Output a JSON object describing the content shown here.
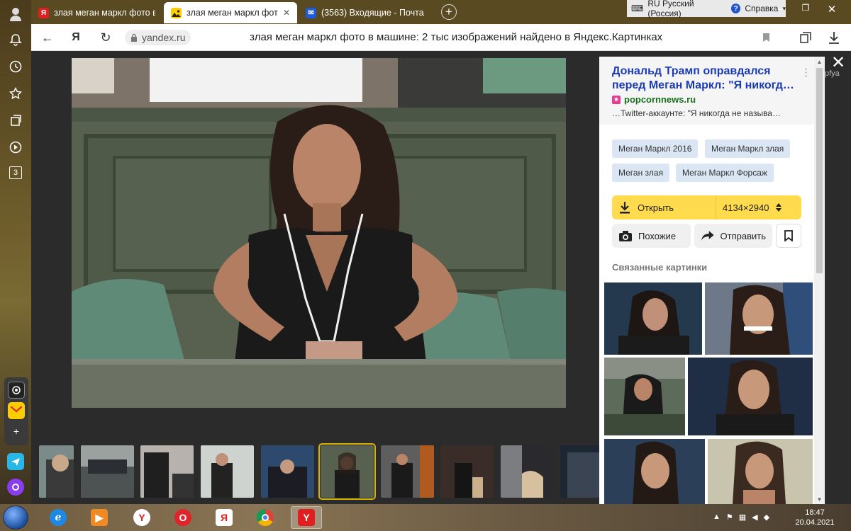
{
  "browser": {
    "tabs": [
      {
        "title": "злая меган маркл фото в",
        "favicon": "yandex-favicon",
        "favicon_text": "Я",
        "active": false
      },
      {
        "title": "злая меган маркл фото",
        "favicon": "images-favicon",
        "favicon_text": "",
        "active": true
      },
      {
        "title": "(3563) Входящие - Почта",
        "favicon": "mail-favicon",
        "favicon_text": "✉",
        "active": false
      }
    ],
    "new_tab": "+",
    "language": "RU Русский (Россия)",
    "help": "Справка",
    "url": "yandex.ru",
    "page_title": "злая меган маркл фото в машине: 2 тыс изображений найдено в Яндекс.Картинках"
  },
  "sidebar": {
    "badge": "3"
  },
  "panel": {
    "headline": "Дональд Трамп оправдался перед Меган Маркл: \"Я никогд…",
    "source": "popcornnews.ru",
    "snippet": "…Twitter-аккаунте: \"Я никогда не называ…",
    "tags": [
      "Меган Маркл 2016",
      "Меган Маркл злая",
      "Меган злая",
      "Меган Маркл Форсаж"
    ],
    "open_label": "Открыть",
    "size": "4134×2940",
    "similar_label": "Похожие",
    "share_label": "Отправить",
    "related_title": "Связанные картинки",
    "under_text": "рfya"
  },
  "taskbar": {
    "time": "18:47",
    "date": "20.04.2021"
  },
  "colors": {
    "accent_yellow": "#ffdb4d",
    "link_blue": "#1a3bb3",
    "source_green": "#1a6f1a",
    "tag_bg": "#dbe6f5"
  }
}
